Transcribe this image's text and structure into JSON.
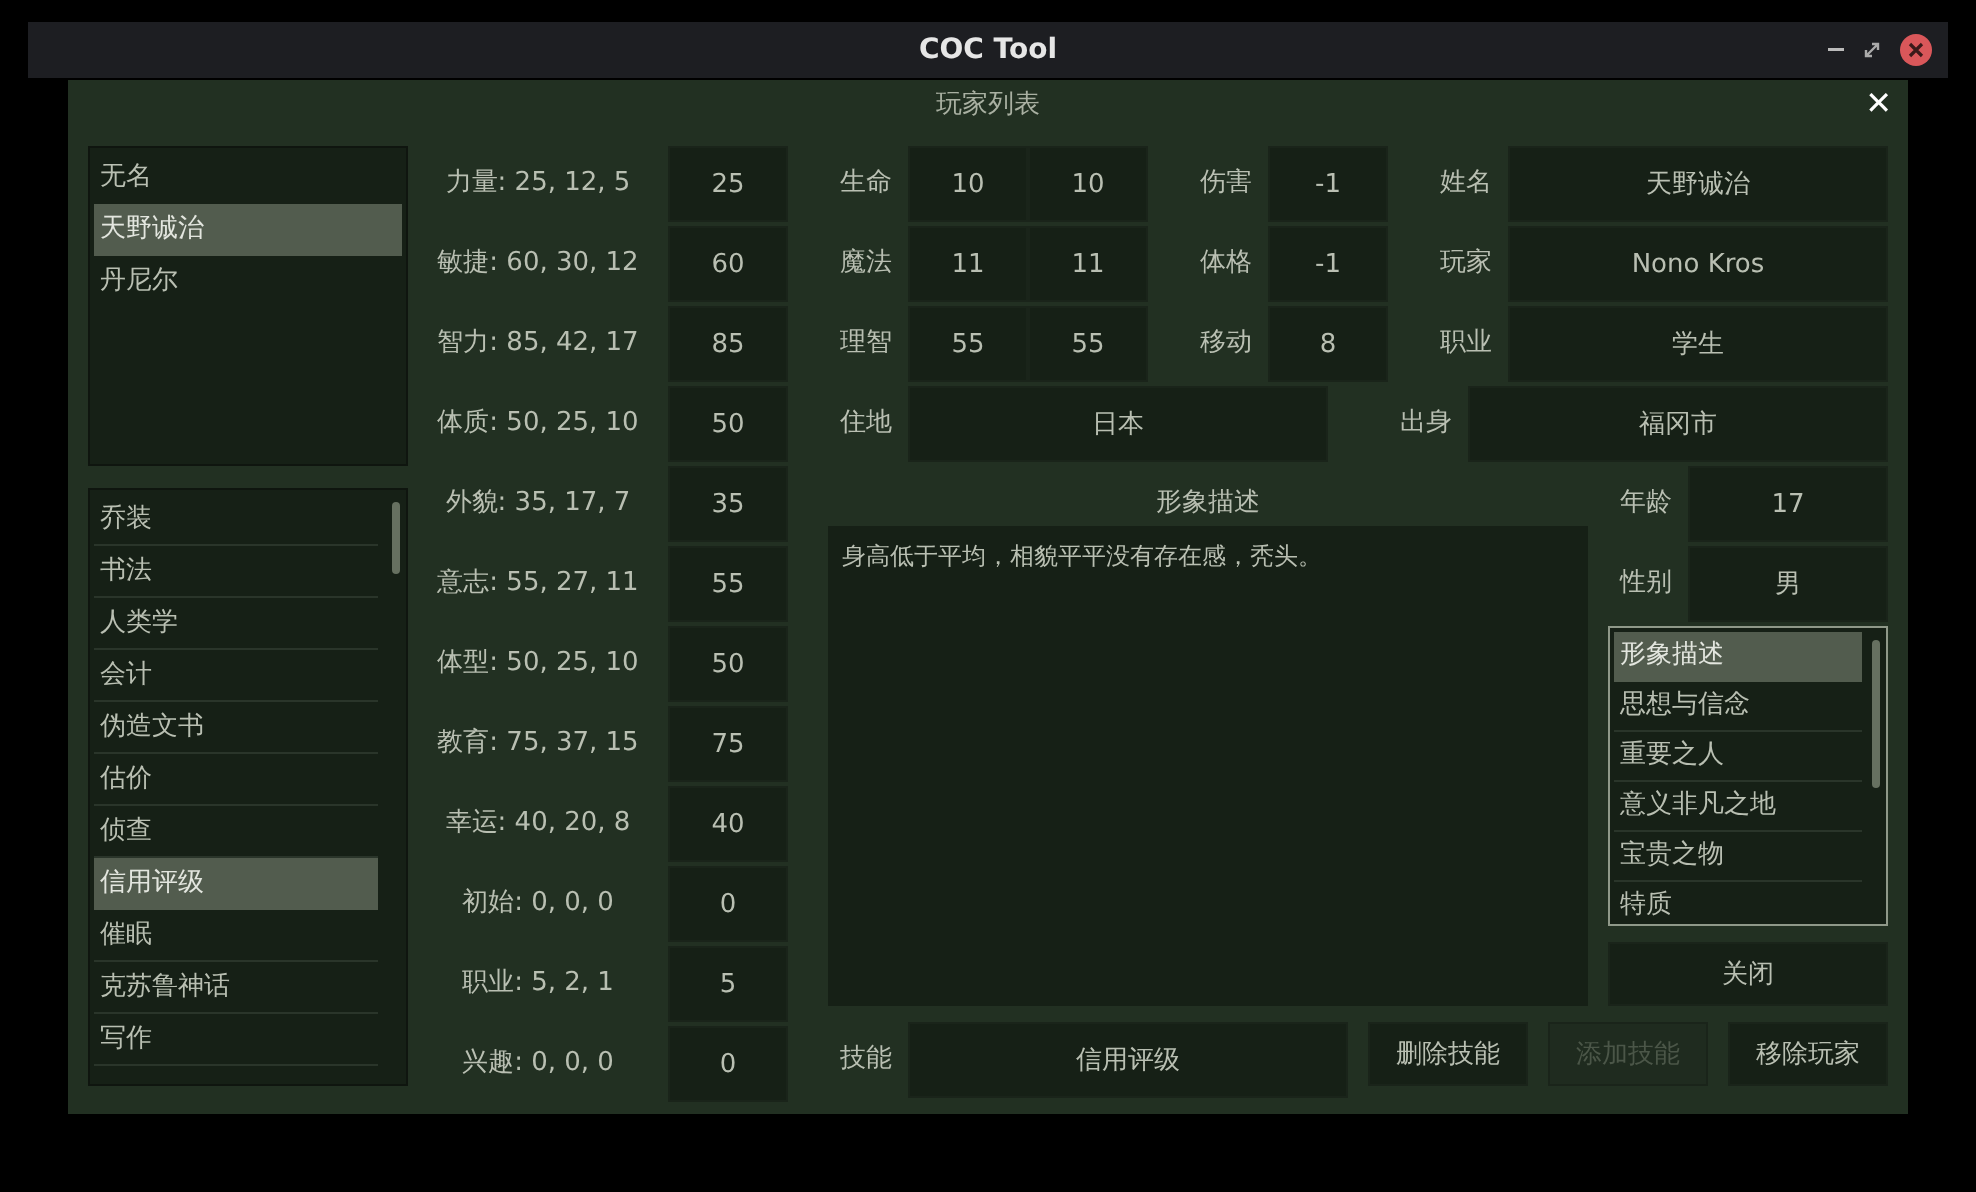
{
  "window": {
    "title": "COC Tool"
  },
  "dialog": {
    "title": "玩家列表",
    "close": "✕"
  },
  "players": [
    {
      "name": "无名",
      "selected": false
    },
    {
      "name": "天野诚治",
      "selected": true
    },
    {
      "name": "丹尼尔",
      "selected": false
    }
  ],
  "skills": [
    {
      "name": "乔装",
      "selected": false
    },
    {
      "name": "书法",
      "selected": false
    },
    {
      "name": "人类学",
      "selected": false
    },
    {
      "name": "会计",
      "selected": false
    },
    {
      "name": "伪造文书",
      "selected": false
    },
    {
      "name": "估价",
      "selected": false
    },
    {
      "name": "侦查",
      "selected": false
    },
    {
      "name": "信用评级",
      "selected": true
    },
    {
      "name": "催眠",
      "selected": false
    },
    {
      "name": "克苏鲁神话",
      "selected": false
    },
    {
      "name": "写作",
      "selected": false
    }
  ],
  "attributes": [
    {
      "label": "力量: 25, 12, 5",
      "value": "25"
    },
    {
      "label": "敏捷: 60, 30, 12",
      "value": "60"
    },
    {
      "label": "智力: 85, 42, 17",
      "value": "85"
    },
    {
      "label": "体质: 50, 25, 10",
      "value": "50"
    },
    {
      "label": "外貌: 35, 17, 7",
      "value": "35"
    },
    {
      "label": "意志: 55, 27, 11",
      "value": "55"
    },
    {
      "label": "体型: 50, 25, 10",
      "value": "50"
    },
    {
      "label": "教育: 75, 37, 15",
      "value": "75"
    },
    {
      "label": "幸运: 40, 20, 8",
      "value": "40"
    },
    {
      "label": "初始: 0, 0, 0",
      "value": "0"
    },
    {
      "label": "职业: 5, 2, 1",
      "value": "5"
    },
    {
      "label": "兴趣: 0, 0, 0",
      "value": "0"
    }
  ],
  "stat_rows": [
    {
      "label": "生命",
      "current": "10",
      "max": "10",
      "mid_label": "伤害",
      "mid_value": "-1",
      "right_label": "姓名",
      "right_value": "天野诚治"
    },
    {
      "label": "魔法",
      "current": "11",
      "max": "11",
      "mid_label": "体格",
      "mid_value": "-1",
      "right_label": "玩家",
      "right_value": "Nono Kros"
    },
    {
      "label": "理智",
      "current": "55",
      "max": "55",
      "mid_label": "移动",
      "mid_value": "8",
      "right_label": "职业",
      "right_value": "学生"
    }
  ],
  "residence": {
    "label": "住地",
    "value": "日本"
  },
  "birthplace": {
    "label": "出身",
    "value": "福冈市"
  },
  "description": {
    "title": "形象描述",
    "text": "身高低于平均，相貌平平没有存在感，秃头。"
  },
  "age": {
    "label": "年龄",
    "value": "17"
  },
  "gender": {
    "label": "性别",
    "value": "男"
  },
  "sections": [
    {
      "name": "形象描述",
      "selected": true
    },
    {
      "name": "思想与信念",
      "selected": false
    },
    {
      "name": "重要之人",
      "selected": false
    },
    {
      "name": "意义非凡之地",
      "selected": false
    },
    {
      "name": "宝贵之物",
      "selected": false
    },
    {
      "name": "特质",
      "selected": false
    }
  ],
  "close_button": "关闭",
  "skill": {
    "label": "技能",
    "value": "信用评级"
  },
  "actions": [
    {
      "label": "删除技能",
      "disabled": false
    },
    {
      "label": "添加技能",
      "disabled": true
    },
    {
      "label": "移除玩家",
      "disabled": false
    }
  ]
}
